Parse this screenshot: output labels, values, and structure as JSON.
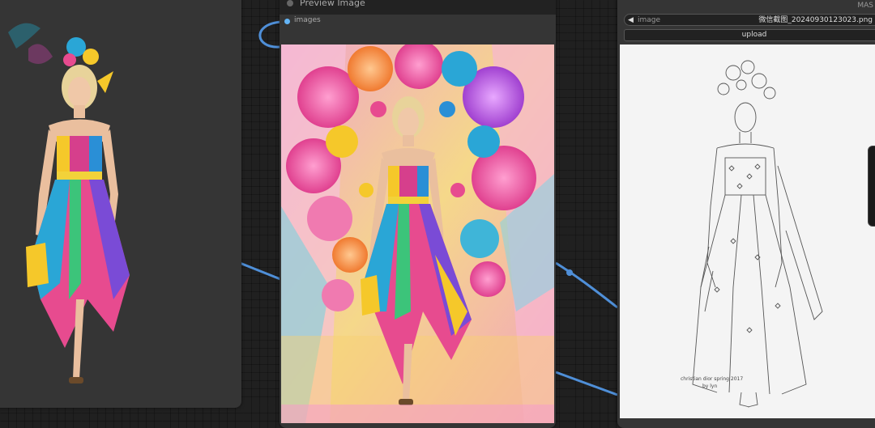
{
  "preview_node": {
    "title": "Preview Image",
    "output_label": "images"
  },
  "load_image_node": {
    "mask_label": "MAS",
    "image_widget": {
      "label": "image",
      "value": "微信截图_20240930123023.png"
    },
    "upload_label": "upload",
    "sketch_caption_line1": "christian dior spring 2017",
    "sketch_caption_line2": "by lyn"
  },
  "colors": {
    "canvas_bg": "#202020",
    "node_bg": "#353535",
    "link_color": "#4f8fd8",
    "slot_dot": "#64b5f6"
  },
  "icons": [
    "left-arrow-icon"
  ]
}
